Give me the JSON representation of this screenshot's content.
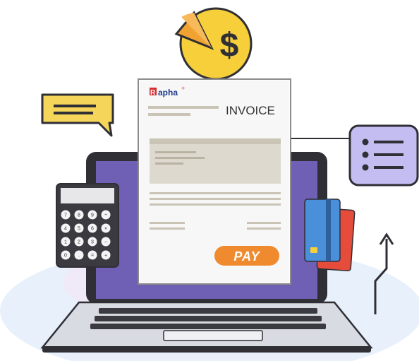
{
  "invoice": {
    "brand": "apha",
    "brand_mark": "R",
    "brand_plus": "+",
    "title": "INVOICE",
    "pay_label": "PAY"
  },
  "calculator": {
    "keys": [
      [
        "7",
        "8",
        "9",
        "÷"
      ],
      [
        "4",
        "5",
        "6",
        "×"
      ],
      [
        "1",
        "2",
        "3",
        "−"
      ],
      [
        "0",
        ".",
        "=",
        "+"
      ]
    ]
  },
  "icons": {
    "coin": "dollar-coin-icon",
    "pie": "pie-chart-icon",
    "chat": "chat-bubble-icon",
    "list": "list-card-icon",
    "cards": "credit-cards-icon",
    "arrow": "growth-arrow-icon"
  },
  "colors": {
    "laptop_screen": "#6f5fb5",
    "laptop_body": "#2f2f35",
    "coin": "#f6cf3a",
    "pie_slice": "#f0a330",
    "chat_bubble": "#f6d65a",
    "list_card": "#c4bdf2",
    "pay_button": "#ef8a2f",
    "card_blue": "#4a8fd9",
    "card_red": "#e64c3c",
    "background_blob": "#e6f0fa"
  }
}
